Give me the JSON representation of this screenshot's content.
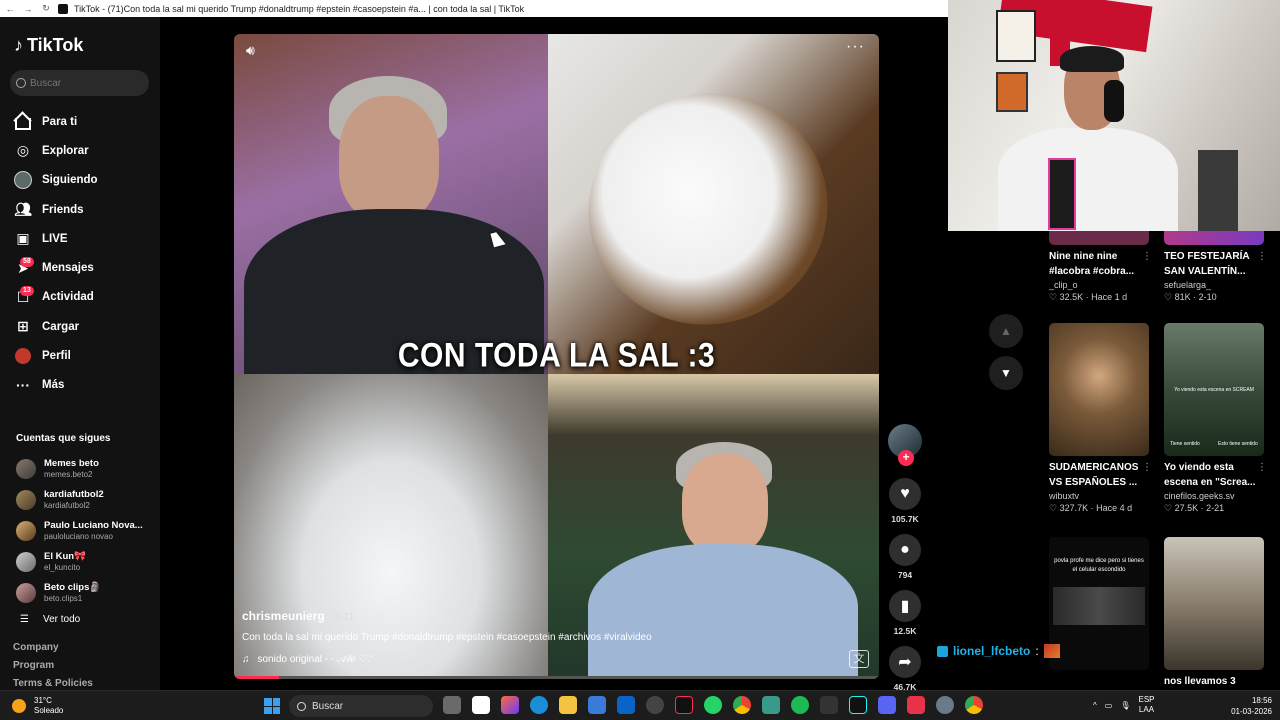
{
  "browser": {
    "title": "TikTok - (71)Con toda la sal mi querido Trump #donaldtrump #epstein #casoepstein #a... | con toda la sal | TikTok"
  },
  "sidebar": {
    "logo": "TikTok",
    "search_placeholder": "Buscar",
    "nav": [
      {
        "label": "Para ti",
        "icon": "home-icon",
        "active": true
      },
      {
        "label": "Explorar",
        "icon": "compass-icon"
      },
      {
        "label": "Siguiendo",
        "icon": "following-avatar-icon"
      },
      {
        "label": "Friends",
        "icon": "friends-icon"
      },
      {
        "label": "LIVE",
        "icon": "live-icon"
      },
      {
        "label": "Mensajes",
        "icon": "messages-icon",
        "badge": "58"
      },
      {
        "label": "Actividad",
        "icon": "activity-icon",
        "badge": "13"
      },
      {
        "label": "Cargar",
        "icon": "upload-icon"
      },
      {
        "label": "Perfil",
        "icon": "profile-avatar-icon"
      },
      {
        "label": "Más",
        "icon": "more-icon"
      }
    ],
    "following_title": "Cuentas que sigues",
    "following": [
      {
        "name": "Memes beto",
        "user": "memes.beto2"
      },
      {
        "name": "kardiafutbol2",
        "user": "kardiafutbol2"
      },
      {
        "name": "Paulo Luciano Nova...",
        "user": "pauloluciano novao"
      },
      {
        "name": "El Kun🎀",
        "user": "el_kuncito"
      },
      {
        "name": "Beto clips🗿",
        "user": "beto.clips1"
      }
    ],
    "see_all": "Ver todo",
    "footer": [
      "Company",
      "Program",
      "Terms & Policies"
    ]
  },
  "video": {
    "overlay_text": "CON TODA LA SAL :3",
    "author": "chrismeunierg",
    "date": "· 2-21",
    "description": "Con toda la sal mi querido Trump #donaldtrump #epstein #casoepstein #archivos #viralvideo",
    "sound": "sonido original - - 𝒜𝓁ℯ ♡.'",
    "progress": 0.07
  },
  "actions": {
    "likes": "105.7K",
    "comments": "794",
    "saves": "12.5K",
    "shares": "46.7K"
  },
  "recommended": [
    {
      "title1": "Nine nine nine",
      "title2": "#lacobra #cobra...",
      "user": "_clip_o",
      "meta": "♡ 32.5K · Hace 1 d"
    },
    {
      "title1": "TEO FESTEJARÍA",
      "title2": "SAN VALENTÍN...",
      "user": "sefuelarga_",
      "meta": "♡ 81K · 2-10"
    },
    {
      "title1": "SUDAMERICANOS",
      "title2": "VS ESPAÑOLES ...",
      "user": "wibuxtv",
      "meta": "♡ 327.7K · Hace 4 d"
    },
    {
      "title1": "Yo viendo esta",
      "title2": "escena en \"Screa...",
      "user": "cinefilos.geeks.sv",
      "meta": "♡ 27.5K · 2-21"
    },
    {
      "title1": "",
      "title2": "",
      "user": "",
      "meta": "",
      "thumb_text": "povla profe me dice pero si tienes el celular escondido"
    },
    {
      "title1": "nos llevamos 3",
      "title2": "",
      "user": "",
      "meta": ""
    }
  ],
  "thumb_captions": {
    "scream1": "Yo viendo esta escena en SCREAM",
    "scream2": "Tiene sentido",
    "scream3": "Esto tiene sentido"
  },
  "chat": {
    "user": "lionel_lfcbeto",
    "sep": ":"
  },
  "taskbar": {
    "temp": "31°C",
    "weather": "Soleado",
    "search": "Buscar",
    "lang1": "ESP",
    "lang2": "LAA",
    "time": "18:56",
    "date": "01-03-2026"
  }
}
